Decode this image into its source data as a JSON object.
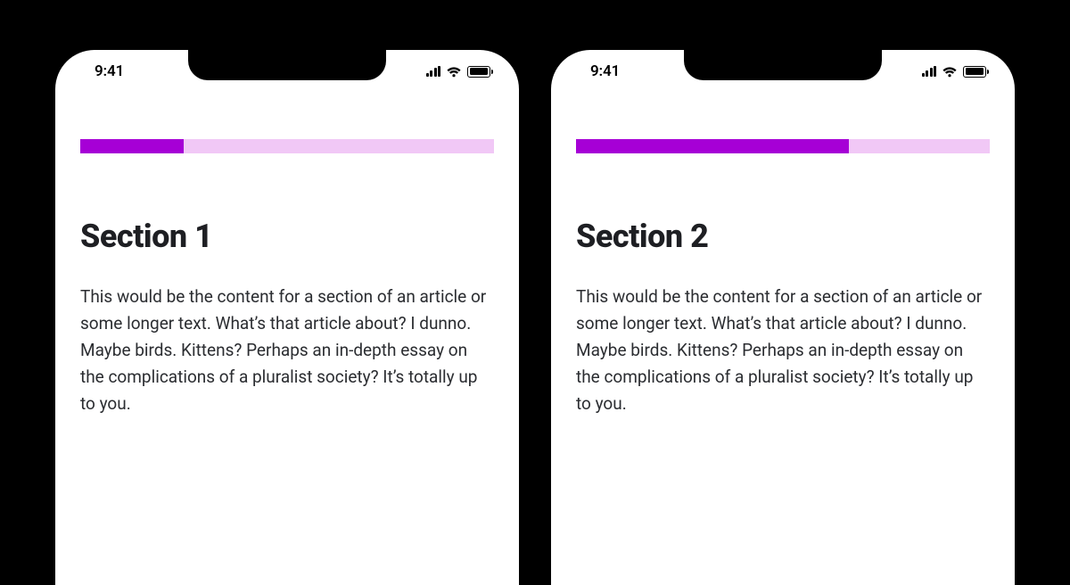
{
  "status": {
    "time": "9:41",
    "signal_icon": "cellular-signal-icon",
    "wifi_icon": "wifi-icon",
    "battery_icon": "battery-full-icon"
  },
  "screens": [
    {
      "progress_percent": 25,
      "title": "Section 1",
      "body": "This would be the content for a section of an article or some longer text. What’s that article about? I dunno. Maybe birds. Kittens? Perhaps an in-depth essay on the complications of a pluralist society? It’s totally up to you."
    },
    {
      "progress_percent": 66,
      "title": "Section 2",
      "body": "This would be the content for a section of an article or some longer text. What’s that article about? I dunno. Maybe birds. Kittens? Perhaps an in-depth essay on the complications of a pluralist society? It’s totally up to you."
    }
  ],
  "colors": {
    "progress_track": "#f1c8f6",
    "progress_fill": "#a600d6"
  }
}
